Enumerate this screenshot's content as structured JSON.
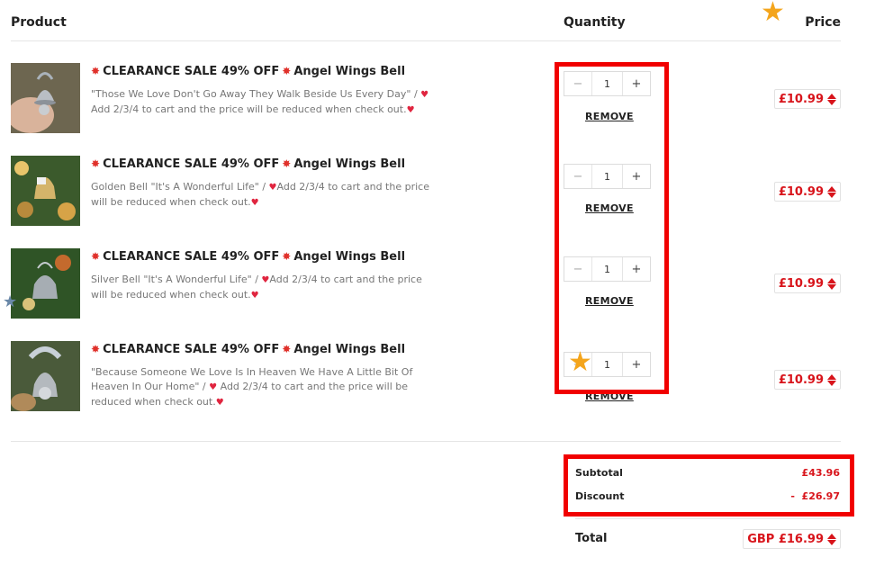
{
  "header": {
    "product": "Product",
    "quantity": "Quantity",
    "price": "Price"
  },
  "items": [
    {
      "title": "CLEARANCE SALE 49% OFF",
      "title_suffix": "Angel Wings Bell",
      "desc_main": "\"Those We Love Don't Go Away They Walk Beside Us Every Day\" /",
      "desc_tail": "Add 2/3/4 to cart and the price will be reduced when check out.",
      "qty": "1",
      "remove": "REMOVE",
      "price": "£10.99"
    },
    {
      "title": "CLEARANCE SALE 49% OFF",
      "title_suffix": "Angel Wings Bell",
      "desc_main": "Golden Bell \"It's A Wonderful Life\" /",
      "desc_tail": "Add 2/3/4 to cart and the price will be reduced when check out.",
      "qty": "1",
      "remove": "REMOVE",
      "price": "£10.99"
    },
    {
      "title": "CLEARANCE SALE 49% OFF",
      "title_suffix": "Angel Wings Bell",
      "desc_main": "Silver Bell \"It's A Wonderful Life\" /",
      "desc_tail": "Add 2/3/4 to cart and the price will be reduced when check out.",
      "qty": "1",
      "remove": "REMOVE",
      "price": "£10.99"
    },
    {
      "title": "CLEARANCE SALE 49% OFF",
      "title_suffix": "Angel Wings Bell",
      "desc_main": "\"Because Someone We Love Is In Heaven We Have A Little Bit Of Heaven In Our Home\" /",
      "desc_tail": "Add 2/3/4 to cart and the price will be reduced when check out.",
      "qty": "1",
      "remove": "REMOVE",
      "price": "£10.99"
    }
  ],
  "summary": {
    "subtotal_label": "Subtotal",
    "subtotal_value": "£43.96",
    "discount_label": "Discount",
    "discount_value": "-  £26.97",
    "total_label": "Total",
    "total_value": "GBP £16.99"
  },
  "icons": {
    "burst": "burst-icon",
    "heart": "heart-icon",
    "minus": "minus-icon",
    "plus": "plus-icon",
    "sort": "sort-arrows-icon",
    "star": "star-icon"
  },
  "colors": {
    "accent_red": "#d8141b",
    "highlight_red": "#f10000",
    "star_orange": "#f4a51c"
  }
}
